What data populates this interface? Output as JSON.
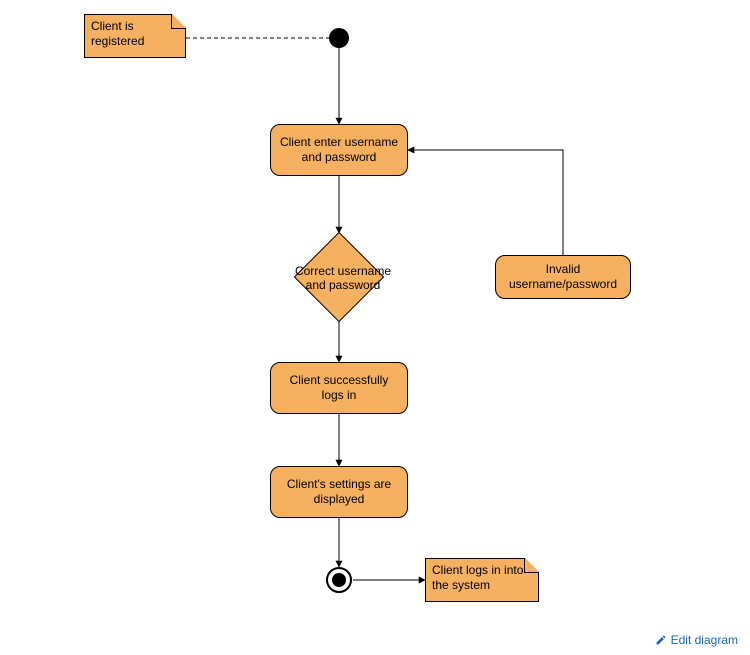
{
  "notes": {
    "precondition": "Client is registered",
    "postcondition": "Client logs in into the system"
  },
  "activities": {
    "enter_credentials": "Client enter username and password",
    "login_success": "Client successfully logs in",
    "settings_shown": "Client's settings are displayed",
    "invalid": "Invalid username/password"
  },
  "decision": {
    "check_credentials": "Correct username and password"
  },
  "ui": {
    "edit_link": "Edit diagram"
  },
  "colors": {
    "node_fill": "#f5b060",
    "node_stroke": "#000000",
    "link": "#1565c0"
  }
}
